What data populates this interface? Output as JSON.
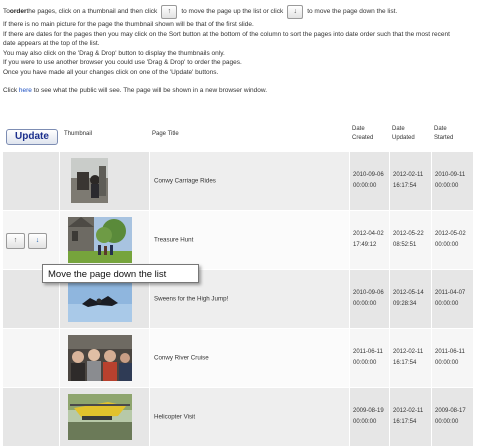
{
  "instructions": {
    "intro_before_bold": "To ",
    "intro_bold": "order",
    "intro_mid1": " the pages, click on a thumbnail and then click",
    "intro_mid2": "to move the page up the list or click",
    "intro_end": "to move the page down the list.",
    "line2": "If there is no main picture for the page the thumbnail shown will be that of the first slide.",
    "line3": "If there are dates for the pages then you may click on the Sort button at the bottom of the column to sort the pages into date order such that the most recent",
    "line4": "date appears at the top of the list.",
    "line5": "You may also click on the 'Drag & Drop' button to display the thumbnails only.",
    "line6": "If you were to use another browser you could use 'Drag & Drop' to order the pages.",
    "line7": "Once you have made all your changes click on one of the 'Update' buttons.",
    "public_before": "Click ",
    "public_link": "here",
    "public_after": " to see what the public will see. The page will be shown in a new browser window."
  },
  "buttons": {
    "up_glyph": "↑",
    "down_glyph": "↓",
    "update": "Update"
  },
  "table": {
    "headers": {
      "thumbnail": "Thumbnail",
      "page_title": "Page Title",
      "date_created": "Date\nCreated",
      "date_updated": "Date\nUpdated",
      "date_started": "Date\nStarted"
    },
    "rows": [
      {
        "title": "Conwy Carriage Rides",
        "created": "2010-09-06",
        "created_time": "00:00:00",
        "updated": "2012-02-11",
        "updated_time": "16:17:54",
        "started": "2010-09-11",
        "started_time": "00:00:00"
      },
      {
        "title": "Treasure Hunt",
        "created": "2012-04-02",
        "created_time": "17:49:12",
        "updated": "2012-05-22",
        "updated_time": "08:52:51",
        "started": "2012-05-02",
        "started_time": "00:00:00"
      },
      {
        "title": "Sweens for the High Jump!",
        "created": "2010-09-06",
        "created_time": "00:00:00",
        "updated": "2012-05-14",
        "updated_time": "09:28:34",
        "started": "2011-04-07",
        "started_time": "00:00:00"
      },
      {
        "title": "Conwy River Cruise",
        "created": "2011-06-11",
        "created_time": "00:00:00",
        "updated": "2012-02-11",
        "updated_time": "16:17:54",
        "started": "2011-06-11",
        "started_time": "00:00:00"
      },
      {
        "title": "Helicopter Visit",
        "created": "2009-08-19",
        "created_time": "00:00:00",
        "updated": "2012-02-11",
        "updated_time": "16:17:54",
        "started": "2009-08-17",
        "started_time": "00:00:00"
      }
    ]
  },
  "tooltip": "Move the page down the list",
  "colors": {
    "link": "#1a4ec2",
    "update_text": "#1c2f8c",
    "row_shade": "#e6e6e6"
  }
}
